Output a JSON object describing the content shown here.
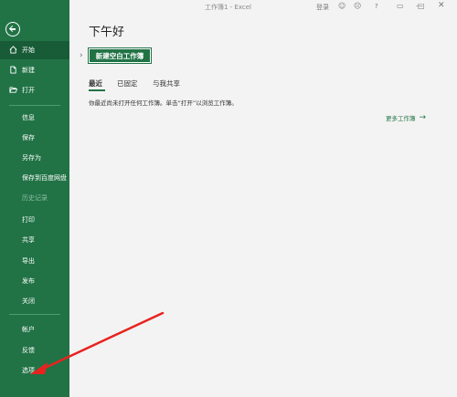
{
  "window": {
    "title": "工作簿1 - Excel",
    "signin": "登录",
    "help": "?"
  },
  "sidebar": {
    "top_items": [
      {
        "label": "开始",
        "icon": "home-icon"
      },
      {
        "label": "新建",
        "icon": "new-file-icon"
      },
      {
        "label": "打开",
        "icon": "open-folder-icon"
      }
    ],
    "items": [
      "信息",
      "保存",
      "另存为",
      "保存到百度网盘",
      "历史记录",
      "打印",
      "共享",
      "导出",
      "发布",
      "关闭"
    ],
    "bottom_items": [
      "帐户",
      "反馈",
      "选项"
    ]
  },
  "main": {
    "greeting": "下午好",
    "new_workbook": "新建空白工作簿",
    "tabs": [
      "最近",
      "已固定",
      "与我共享"
    ],
    "empty_message": "你最近尚未打开任何工作簿。单击“打开”以浏览工作簿。",
    "more_workbooks": "更多工作簿"
  },
  "colors": {
    "accent": "#217346",
    "active": "#185c37",
    "annotation_arrow": "#e8231e"
  }
}
